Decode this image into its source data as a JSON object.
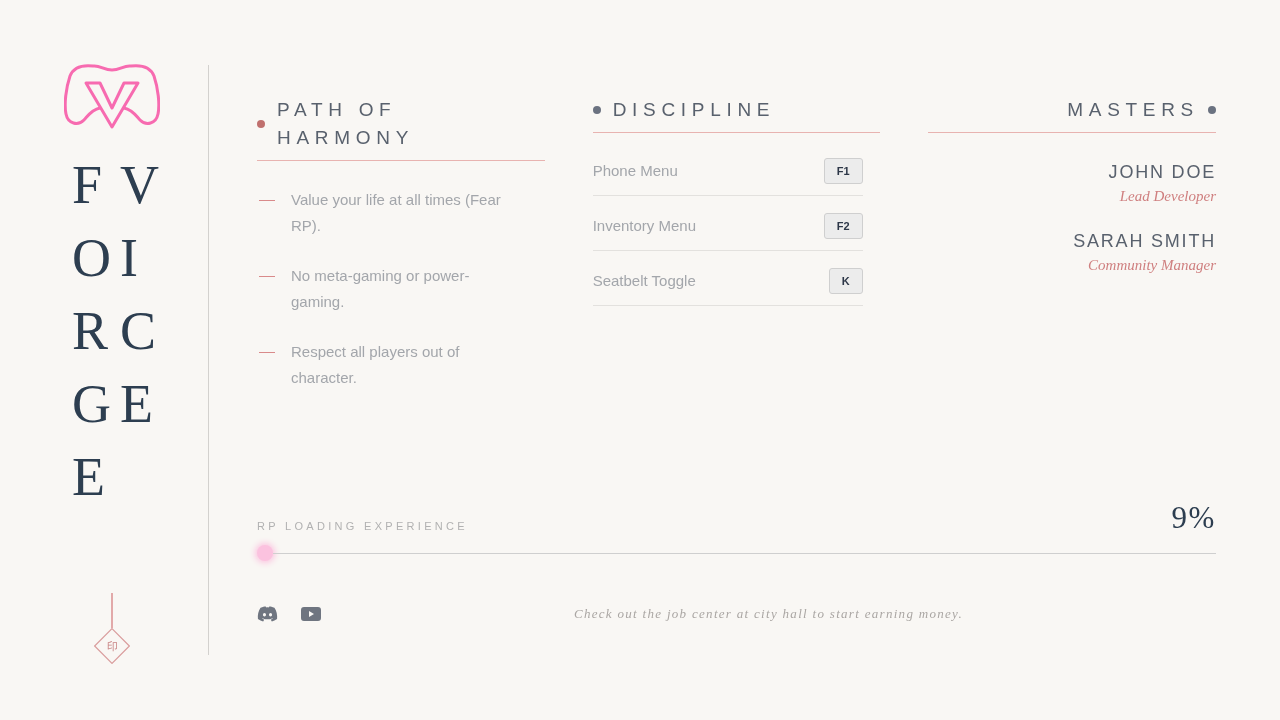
{
  "brand": {
    "words": [
      "FORGE",
      "VICE"
    ],
    "seal": "印"
  },
  "sections": [
    {
      "kind": "rules",
      "title": "PATH OF HARMONY",
      "color": "#c0706e",
      "items": [
        "Value your life at all times (Fear RP).",
        "No meta-gaming or power-gaming.",
        "Respect all players out of character."
      ]
    },
    {
      "kind": "keybinds",
      "title": "DISCIPLINE",
      "color": "#6b7280",
      "items": [
        {
          "label": "Phone Menu",
          "key": "F1"
        },
        {
          "label": "Inventory Menu",
          "key": "F2"
        },
        {
          "label": "Seatbelt Toggle",
          "key": "K"
        }
      ]
    },
    {
      "kind": "staff",
      "title": "MASTERS",
      "color": "#6b7280",
      "items": [
        {
          "name": "JOHN DOE",
          "role": "Lead Developer"
        },
        {
          "name": "SARAH SMITH",
          "role": "Community Manager"
        }
      ]
    }
  ],
  "progress": {
    "label": "RP LOADING EXPERIENCE",
    "reading": "9%",
    "level": 0
  },
  "footer": {
    "tip": "Check out the job center at city hall to start earning money."
  }
}
